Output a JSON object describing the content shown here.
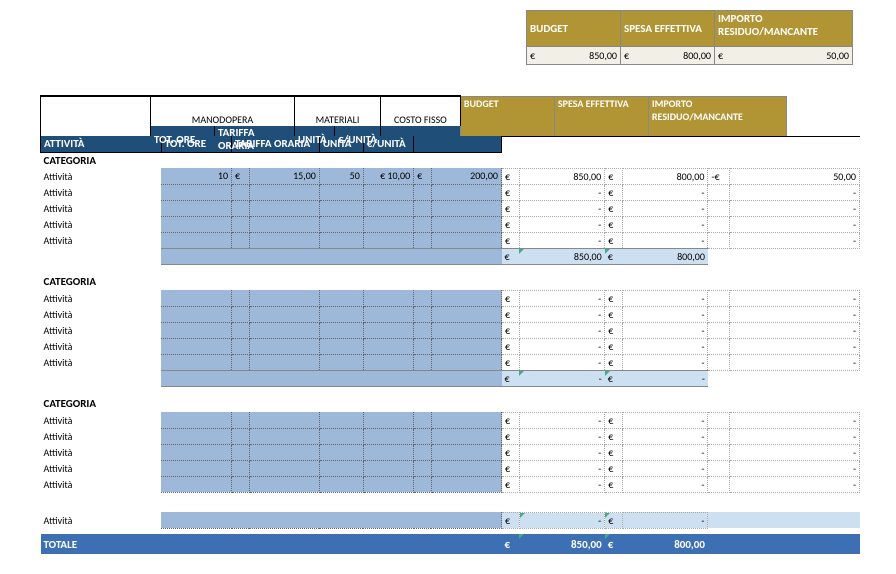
{
  "summary": {
    "headers": [
      "BUDGET",
      "SPESA EFFETTIVA",
      "IMPORTO RESIDUO/MANCANTE"
    ],
    "row": {
      "budget_cur": "€",
      "budget": "850,00",
      "spent_cur": "€",
      "spent": "800,00",
      "rem_cur": "€",
      "rem": "50,00"
    }
  },
  "main_headers": {
    "manodopera": "MANODOPERA",
    "materiali": "MATERIALI",
    "costo_fisso": "COSTO FISSO",
    "budget": "BUDGET",
    "spesa": "SPESA EFFETTIVA",
    "importo": "IMPORTO RESIDUO/MANCANTE"
  },
  "navy": {
    "attivita": "ATTIVITÀ",
    "tot_ore": "TOT. ORE",
    "tariffa": "TARIFFA ORARIA",
    "unita": "UNITÀ",
    "eur_unita": "€/UNITÀ"
  },
  "categoria_label": "CATEGORIA",
  "attivita_label": "Attività",
  "groups": [
    {
      "rows": [
        {
          "hours": "10",
          "rate_cur": "€",
          "rate": "15,00",
          "units": "50",
          "unit_price": "€ 10,00",
          "fixed_cur": "€",
          "fixed": "200,00",
          "bud_cur": "€",
          "bud": "850,00",
          "sp_cur": "€",
          "sp": "800,00",
          "rem_cur": "-€",
          "rem": "50,00"
        },
        {
          "bud_cur": "€",
          "bud": "-",
          "sp_cur": "€",
          "sp": "-",
          "rem": "-"
        },
        {
          "bud_cur": "€",
          "bud": "-",
          "sp_cur": "€",
          "sp": "-",
          "rem": "-"
        },
        {
          "bud_cur": "€",
          "bud": "-",
          "sp_cur": "€",
          "sp": "-",
          "rem": "-"
        },
        {
          "bud_cur": "€",
          "bud": "-",
          "sp_cur": "€",
          "sp": "-",
          "rem": "-"
        }
      ],
      "subtotal": {
        "bud_cur": "€",
        "bud": "850,00",
        "sp_cur": "€",
        "sp": "800,00"
      }
    },
    {
      "rows": [
        {
          "bud_cur": "€",
          "bud": "-",
          "sp_cur": "€",
          "sp": "-",
          "rem": "-"
        },
        {
          "bud_cur": "€",
          "bud": "-",
          "sp_cur": "€",
          "sp": "-",
          "rem": "-"
        },
        {
          "bud_cur": "€",
          "bud": "-",
          "sp_cur": "€",
          "sp": "-",
          "rem": "-"
        },
        {
          "bud_cur": "€",
          "bud": "-",
          "sp_cur": "€",
          "sp": "-",
          "rem": "-"
        },
        {
          "bud_cur": "€",
          "bud": "-",
          "sp_cur": "€",
          "sp": "-",
          "rem": "-"
        }
      ],
      "subtotal": {
        "bud_cur": "€",
        "bud": "-",
        "sp_cur": "€",
        "sp": "-"
      }
    },
    {
      "rows": [
        {
          "bud_cur": "€",
          "bud": "-",
          "sp_cur": "€",
          "sp": "-",
          "rem": "-"
        },
        {
          "bud_cur": "€",
          "bud": "-",
          "sp_cur": "€",
          "sp": "-",
          "rem": "-"
        },
        {
          "bud_cur": "€",
          "bud": "-",
          "sp_cur": "€",
          "sp": "-",
          "rem": "-"
        },
        {
          "bud_cur": "€",
          "bud": "-",
          "sp_cur": "€",
          "sp": "-",
          "rem": "-"
        },
        {
          "bud_cur": "€",
          "bud": "-",
          "sp_cur": "€",
          "sp": "-",
          "rem": "-"
        }
      ],
      "subtotal": null
    }
  ],
  "loose_row": {
    "bud_cur": "€",
    "bud": "-",
    "sp_cur": "€",
    "sp": "-"
  },
  "total": {
    "label": "TOTALE",
    "bud_cur": "€",
    "bud": "850,00",
    "sp_cur": "€",
    "sp": "800,00"
  }
}
